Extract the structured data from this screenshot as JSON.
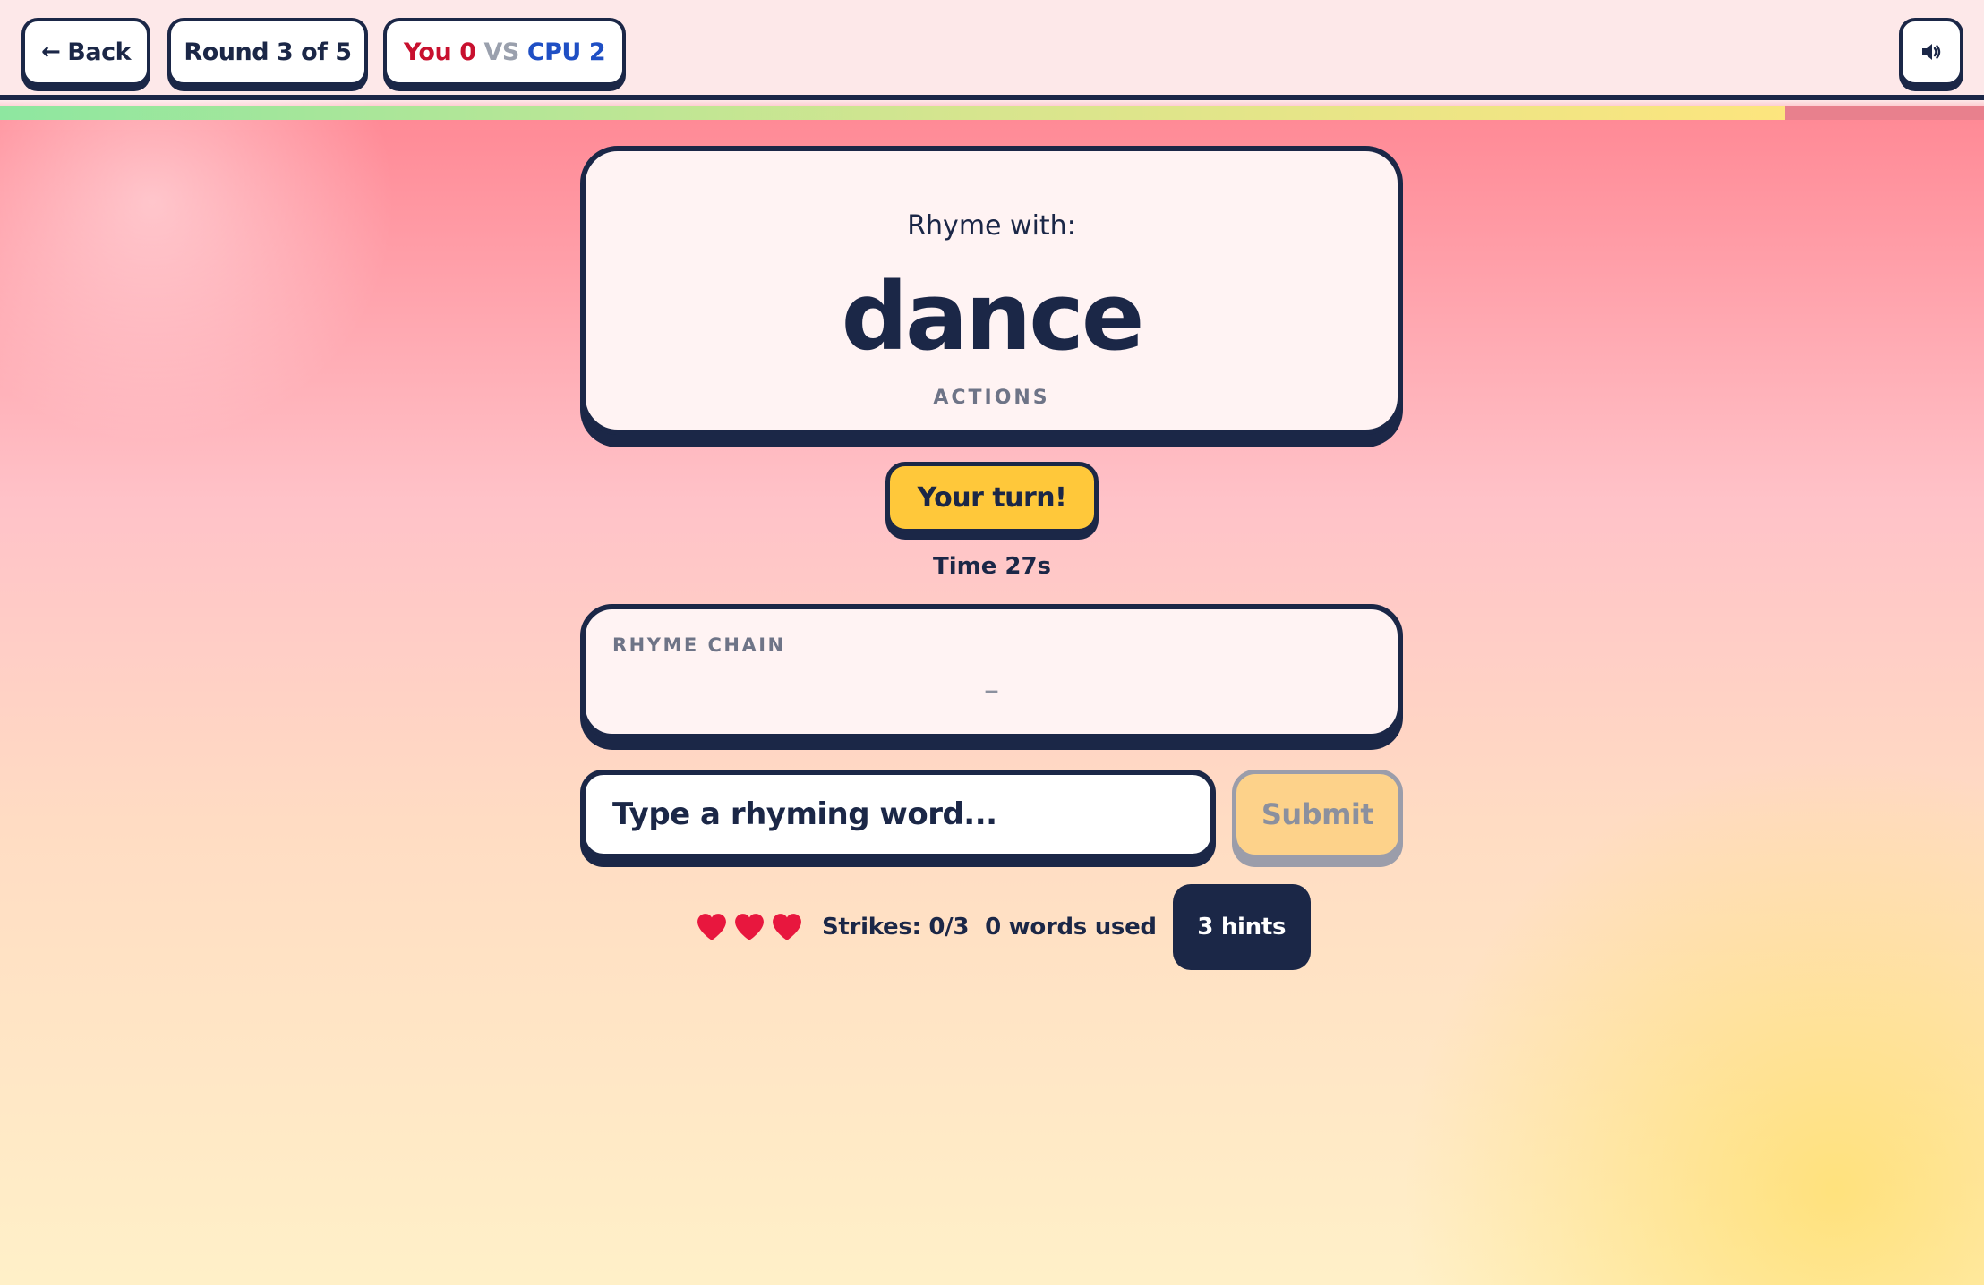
{
  "header": {
    "back_label": "Back",
    "round_label": "Round 3 of 5",
    "you_label": "You",
    "you_score": "0",
    "vs_label": "VS",
    "cpu_label": "CPU",
    "cpu_score": "2",
    "sound_icon": "speaker-icon"
  },
  "progress": {
    "fraction": 0.9,
    "colors": {
      "start": "#8ee7a0",
      "end": "#fde57e",
      "track": "#e8808d"
    }
  },
  "prompt": {
    "instruction": "Rhyme with:",
    "word": "dance",
    "category": "ACTIONS"
  },
  "turn": {
    "badge": "Your turn!",
    "timer": "Time 27s"
  },
  "chain": {
    "label": "RHYME CHAIN",
    "empty": "–"
  },
  "input": {
    "placeholder": "Type a rhyming word...",
    "value": "",
    "submit_label": "Submit"
  },
  "status": {
    "lives": 3,
    "strikes": "Strikes: 0/3",
    "words_used": "0 words used",
    "hints_label": "3 hints"
  },
  "colors": {
    "navy": "#1b2747",
    "you": "#c8102e",
    "cpu": "#1f4fc4",
    "badge": "#ffc83a",
    "heart": "#e8173e"
  }
}
